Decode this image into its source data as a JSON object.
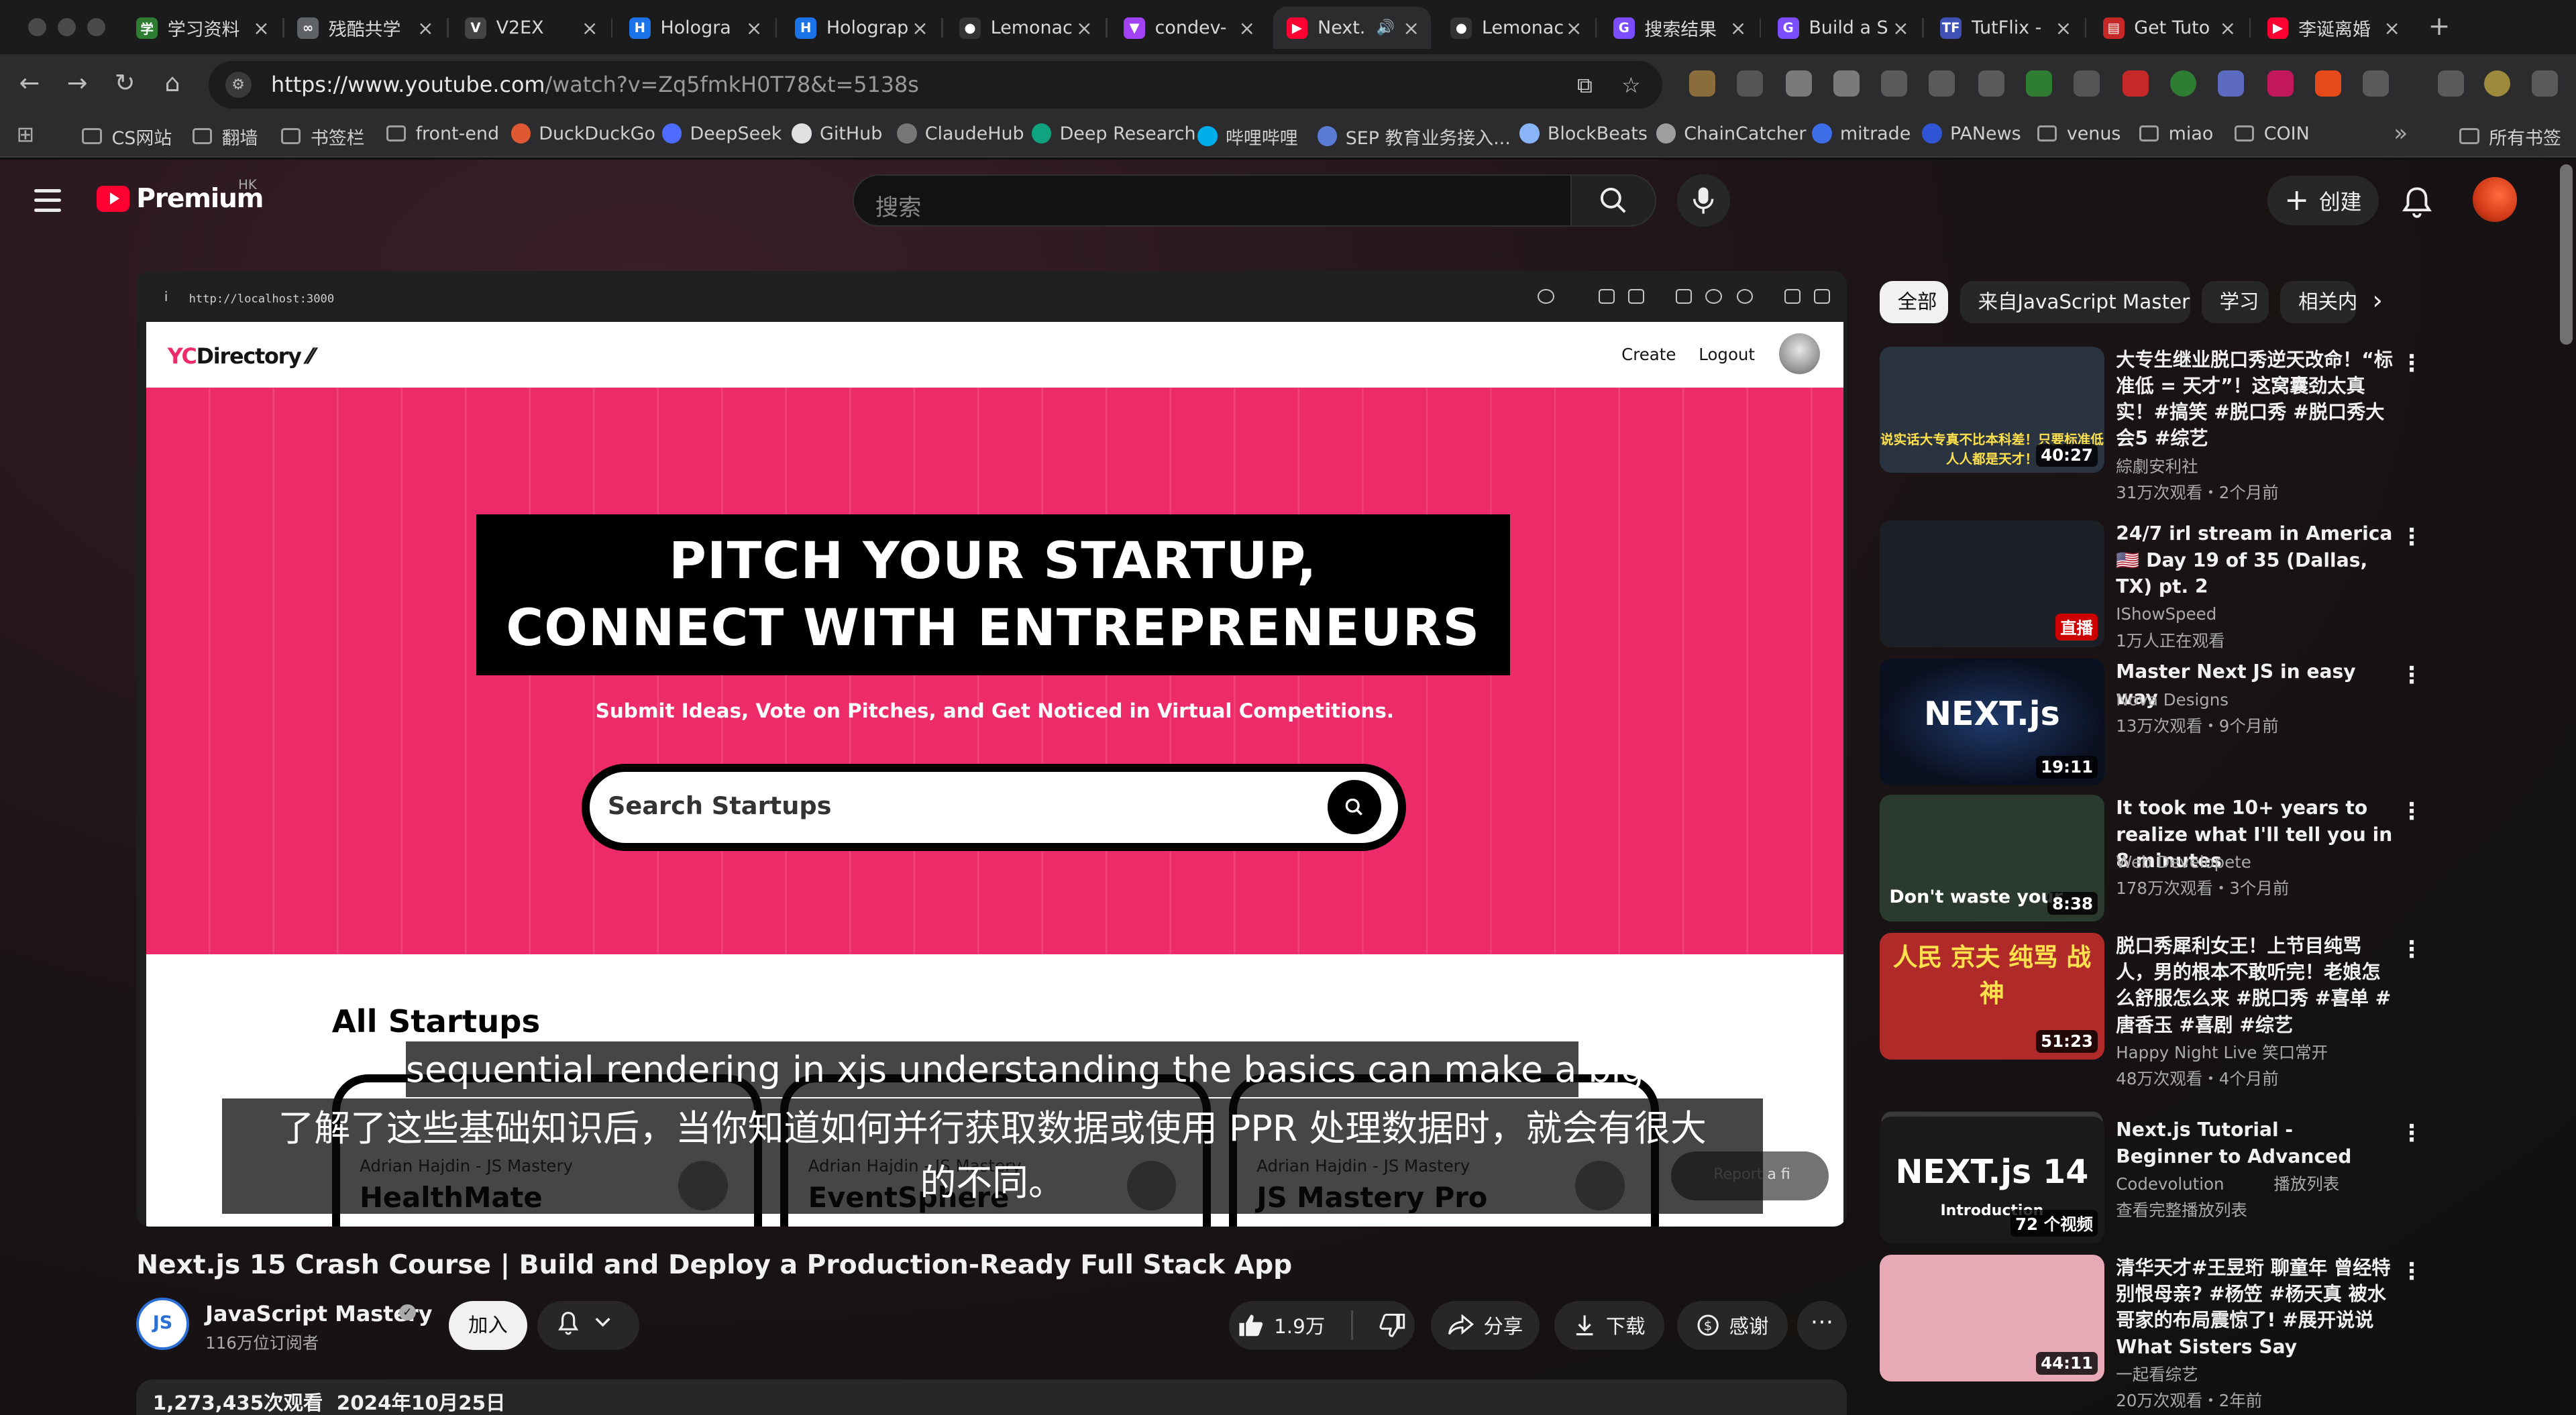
{
  "browser": {
    "tabs": [
      {
        "label": "学习资料",
        "color": "#2e7d32",
        "glyph": "学"
      },
      {
        "label": "残酷共学",
        "color": "#5f6368",
        "glyph": "∞"
      },
      {
        "label": "V2EX",
        "color": "#444444",
        "glyph": "V"
      },
      {
        "label": "Hologra",
        "color": "#1a73e8",
        "glyph": "H"
      },
      {
        "label": "Holograp",
        "color": "#1a73e8",
        "glyph": "H"
      },
      {
        "label": "Lemonac",
        "color": "#333333",
        "glyph": "●"
      },
      {
        "label": "condev-",
        "color": "#a142f4",
        "glyph": "▼"
      },
      {
        "label": "Next.",
        "color": "#ff0033",
        "glyph": "▶"
      },
      {
        "label": "Lemonac",
        "color": "#333333",
        "glyph": "●"
      },
      {
        "label": "搜索结果",
        "color": "#7c4dff",
        "glyph": "G"
      },
      {
        "label": "Build a S",
        "color": "#7c4dff",
        "glyph": "G"
      },
      {
        "label": "TutFlix -",
        "color": "#3f51b5",
        "glyph": "TF"
      },
      {
        "label": "Get Tuto",
        "color": "#c62828",
        "glyph": "▤"
      },
      {
        "label": "李诞离婚",
        "color": "#ff0033",
        "glyph": "▶"
      }
    ],
    "url_host": "https://www.youtube.com",
    "url_path": "/watch?v=Zq5fmkH0T78&t=5138s",
    "bookmarks": [
      {
        "label": "CS网站",
        "kind": "folder"
      },
      {
        "label": "翻墙",
        "kind": "folder"
      },
      {
        "label": "书签栏",
        "kind": "folder"
      },
      {
        "label": "front-end",
        "kind": "folder"
      },
      {
        "label": "DuckDuckGo",
        "kind": "site",
        "color": "#de5833"
      },
      {
        "label": "DeepSeek",
        "kind": "site",
        "color": "#4d6bfe"
      },
      {
        "label": "GitHub",
        "kind": "site",
        "color": "#e0e0e0"
      },
      {
        "label": "ClaudeHub",
        "kind": "site",
        "color": "#777777"
      },
      {
        "label": "Deep Research",
        "kind": "site",
        "color": "#10a37f"
      },
      {
        "label": "哔哩哔哩",
        "kind": "site",
        "color": "#00aeec"
      },
      {
        "label": "SEP 教育业务接入...",
        "kind": "site",
        "color": "#5b7bd5"
      },
      {
        "label": "BlockBeats",
        "kind": "site",
        "color": "#8ab4f8"
      },
      {
        "label": "ChainCatcher",
        "kind": "site",
        "color": "#9e9e9e"
      },
      {
        "label": "mitrade",
        "kind": "site",
        "color": "#3d6ee8"
      },
      {
        "label": "PANews",
        "kind": "site",
        "color": "#2f55d4"
      },
      {
        "label": "venus",
        "kind": "folder"
      },
      {
        "label": "miao",
        "kind": "folder"
      },
      {
        "label": "COIN",
        "kind": "folder"
      }
    ],
    "bookmarks_all": "所有书签"
  },
  "youtube": {
    "logo_text": "Premium",
    "region": "HK",
    "search_placeholder": "搜索",
    "create_label": "创建",
    "player": {
      "inner_url": "http://localhost:3000",
      "site": {
        "logo_yc": "YC",
        "logo_rest": "Directory",
        "nav_create": "Create",
        "nav_logout": "Logout",
        "hero_line1": "PITCH YOUR STARTUP,",
        "hero_line2": "CONNECT WITH ENTREPRENEURS",
        "hero_sub": "Submit Ideas, Vote on Pitches, and Get Noticed in Virtual Competitions.",
        "search_placeholder": "Search Startups",
        "section_title": "All Startups",
        "cards": [
          {
            "author": "Adrian Hajdin - JS Mastery",
            "name": "HealthMate"
          },
          {
            "author": "Adrian Hajdin - JS Mastery",
            "name": "EventSphere"
          },
          {
            "author": "Adrian Hajdin - JS Mastery",
            "name": "JS Mastery Pro"
          }
        ],
        "report_label": "Report a fi"
      },
      "subtitle_en": "sequential rendering in xjs understanding the basics can make a big",
      "subtitle_zh_1": "了解了这些基础知识后，当你知道如何并行获取数据或使用 PPR 处理数据时，就会有很大",
      "subtitle_zh_2": "的不同。"
    },
    "video": {
      "title": "Next.js 15 Crash Course | Build and Deploy a Production-Ready Full Stack App",
      "channel": "JavaScript Mastery",
      "channel_avatar_text": "JS",
      "subscribers": "116万位订阅者",
      "join_label": "加入",
      "likes": "1.9万",
      "share_label": "分享",
      "download_label": "下载",
      "thanks_label": "感谢",
      "views": "1,273,435次观看",
      "date": "2024年10月25日"
    },
    "chips": [
      "全部",
      "来自JavaScript Mastery",
      "学习",
      "相关内"
    ],
    "recommendations": [
      {
        "title": "大专生继业脱口秀逆天改命！“标准低 = 天才”！这窝囊劲太真实！#搞笑 #脱口秀 #脱口秀大会5 #综艺",
        "channel": "綜劇安利社",
        "stats": "31万次观看・2个月前",
        "duration": "40:27",
        "thumb_text": "说实话大专真不比本科差！只要标准低人人都是天才！",
        "thumb_color": "#2a3340"
      },
      {
        "title": "24/7 irl stream in America 🇺🇸 Day 19 of 35 (Dallas, TX) pt. 2",
        "channel": "IShowSpeed",
        "stats": "1万人正在观看",
        "duration": "直播",
        "thumb_text": "",
        "thumb_color": "#1c2026"
      },
      {
        "title": "Master Next JS in easy way",
        "channel": "Nova Designs",
        "stats": "13万次观看・9个月前",
        "duration": "19:11",
        "thumb_text": "NEXT.js",
        "thumb_color": "#0b1020"
      },
      {
        "title": "It took me 10+ years to realize what I'll tell you in 8 minutes",
        "channel": "Web Developete",
        "stats": "178万次观看・3个月前",
        "duration": "8:38",
        "thumb_text": "Don't waste your",
        "thumb_color": "#2b3a2f"
      },
      {
        "title": "脱口秀犀利女王！上节目纯骂人，男的根本不敢听完！老娘怎么舒服怎么来 #脱口秀 #喜单 #唐香玉 #喜剧 #综艺",
        "channel": "Happy Night Live 笑口常开",
        "stats": "48万次观看・4个月前",
        "duration": "51:23",
        "thumb_text": "人民 京夫 纯骂 战神",
        "thumb_color": "#b02a2a"
      },
      {
        "title": "Next.js Tutorial - Beginner to Advanced",
        "channel": "Codevolution",
        "stats": "查看完整播放列表",
        "duration": "72 个视频",
        "thumb_text": "NEXT.js 14",
        "thumb_color": "#1a1a1a",
        "extra": "播放列表",
        "thumb_sub": "Introduction"
      },
      {
        "title": "清华天才#王昱珩 聊童年 曾经特别恨母亲? #杨笠 #杨天真 被水哥家的布局震惊了! #展开说说 What Sisters Say",
        "channel": "一起看综艺",
        "stats": "20万次观看・2年前",
        "duration": "44:11",
        "thumb_text": "",
        "thumb_color": "#e6a9b5"
      }
    ]
  }
}
